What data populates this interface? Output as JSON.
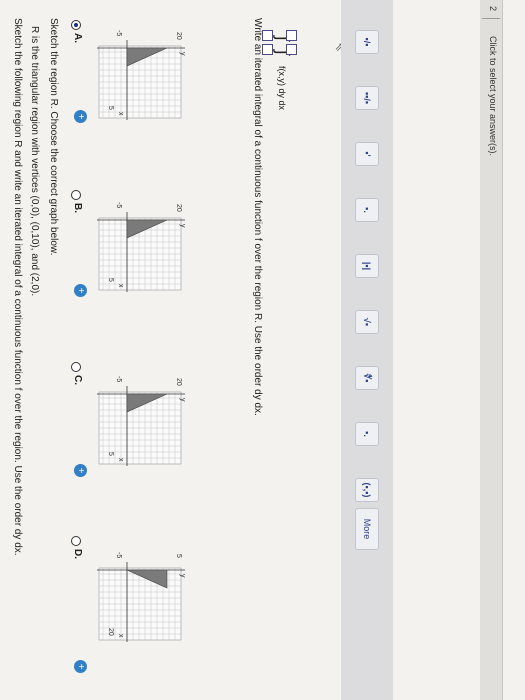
{
  "question": {
    "line1": "Sketch the following region R and write an iterated integral of a continuous function f over the region. Use the order dy dx.",
    "line2": "R is the triangular region with vertices (0,0), (0,10), and (2,0).",
    "line3": "Sketch the region R. Choose the correct graph below."
  },
  "options": [
    {
      "label": "A.",
      "selected": true,
      "ytop": "20",
      "xend": "5",
      "xstart": "-5",
      "ylabel": "y",
      "xlabel": "x"
    },
    {
      "label": "B.",
      "selected": false,
      "ytop": "20",
      "xend": "5",
      "xstart": "-5",
      "ylabel": "y",
      "xlabel": "x"
    },
    {
      "label": "C.",
      "selected": false,
      "ytop": "20",
      "xend": "5",
      "xstart": "-5",
      "ylabel": "y",
      "xlabel": "x"
    },
    {
      "label": "D.",
      "selected": false,
      "ytop": "5",
      "xend": "20",
      "xstart": "-5",
      "ylabel": "y",
      "xlabel": "x"
    }
  ],
  "iterated": {
    "prompt": "Write an iterated integral of a continuous function f over the region R. Use the order dy dx.",
    "integrand": "f(x,y) dy dx"
  },
  "toolbar": {
    "more_label": "More",
    "icons": [
      "fraction-icon",
      "mixed-number-icon",
      "superscript-icon",
      "subscript-icon",
      "absolute-value-icon",
      "sqrt-icon",
      "nth-root-icon",
      "decimal-icon",
      "interval-icon"
    ],
    "glyphs": [
      "▪/▪",
      "▪▪/▪",
      "▪'",
      "▪.",
      "|▪|",
      "√▪",
      "∜▪",
      "▪.",
      "(▪,▪)"
    ]
  },
  "status": {
    "hint": "Click to select your answer(s).",
    "page": "2"
  },
  "colors": {
    "accent": "#2f7fc9",
    "region": "#7a7a7a",
    "grid": "#b8b8b8"
  }
}
